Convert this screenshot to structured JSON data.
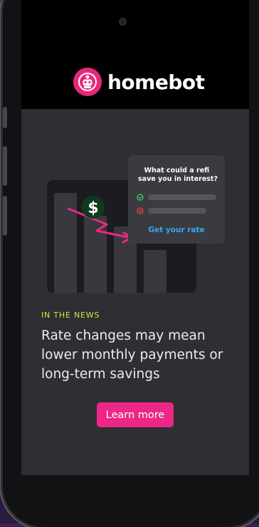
{
  "brand": {
    "name": "homebot",
    "icon": "robot-icon",
    "accent": "#ec2786"
  },
  "card": {
    "question": "What could a refi save you in interest?",
    "currency_symbol": "$",
    "cta": "Get your rate"
  },
  "news": {
    "kicker": "IN THE NEWS",
    "headline": "Rate changes may mean lower monthly payments or long-term savings",
    "cta": "Learn more"
  },
  "colors": {
    "kicker": "#d4e63a",
    "link": "#3aa7ee",
    "check": "#3bd06a",
    "cross": "#ee3d4a"
  }
}
